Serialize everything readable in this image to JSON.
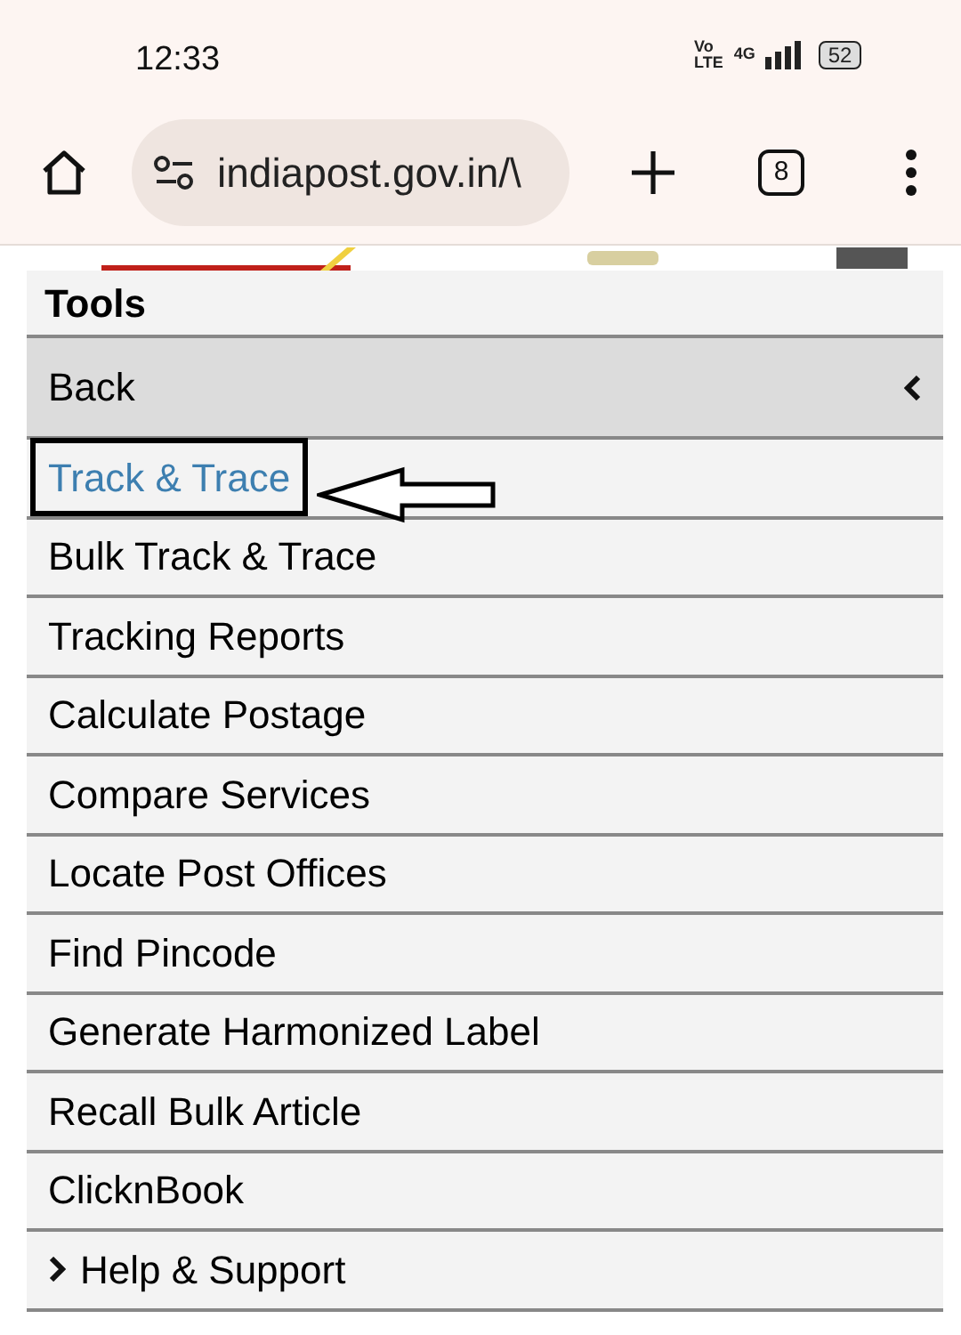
{
  "status_bar": {
    "time": "12:33",
    "volte": [
      "Vo",
      "LTE"
    ],
    "network": "4G",
    "battery": "52"
  },
  "browser": {
    "url": "indiapost.gov.in/\\",
    "tab_count": "8"
  },
  "menu": {
    "title": "Tools",
    "back": "Back",
    "items": [
      {
        "label": "Track & Trace",
        "selected": true,
        "kind": "link"
      },
      {
        "label": "Bulk Track & Trace",
        "selected": false,
        "kind": "link"
      },
      {
        "label": "Tracking Reports",
        "selected": false,
        "kind": "link"
      },
      {
        "label": "Calculate Postage",
        "selected": false,
        "kind": "link"
      },
      {
        "label": "Compare Services",
        "selected": false,
        "kind": "link"
      },
      {
        "label": "Locate Post Offices",
        "selected": false,
        "kind": "link"
      },
      {
        "label": "Find Pincode",
        "selected": false,
        "kind": "link"
      },
      {
        "label": "Generate Harmonized Label",
        "selected": false,
        "kind": "link"
      },
      {
        "label": "Recall Bulk Article",
        "selected": false,
        "kind": "link"
      },
      {
        "label": "ClicknBook",
        "selected": false,
        "kind": "link"
      },
      {
        "label": "Help & Support",
        "selected": false,
        "kind": "submenu"
      }
    ]
  }
}
